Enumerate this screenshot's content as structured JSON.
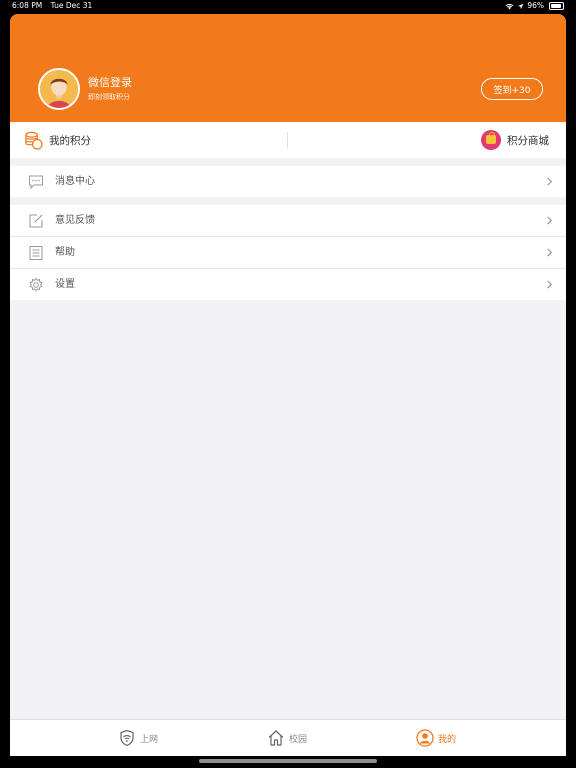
{
  "status_bar": {
    "time": "6:08 PM",
    "date": "Tue Dec 31",
    "battery": "96%"
  },
  "header": {
    "user_name": "微信登录",
    "user_subtitle": "即刻领取积分",
    "checkin_label": "签到+30",
    "background_color": "#f27a1b"
  },
  "points_bar": {
    "my_points_label": "我的积分",
    "mall_label": "积分商城"
  },
  "menu": {
    "group1": [
      {
        "label": "消息中心",
        "icon": "message-icon"
      }
    ],
    "group2": [
      {
        "label": "意见反馈",
        "icon": "feedback-edit-icon"
      },
      {
        "label": "帮助",
        "icon": "help-document-icon"
      },
      {
        "label": "设置",
        "icon": "settings-gear-icon"
      }
    ]
  },
  "tab_bar": {
    "tabs": [
      {
        "label": "上网",
        "icon": "wifi-shield-icon",
        "active": false
      },
      {
        "label": "校园",
        "icon": "home-icon",
        "active": false
      },
      {
        "label": "我的",
        "icon": "user-icon",
        "active": true
      }
    ],
    "active_color": "#f27a1b"
  }
}
